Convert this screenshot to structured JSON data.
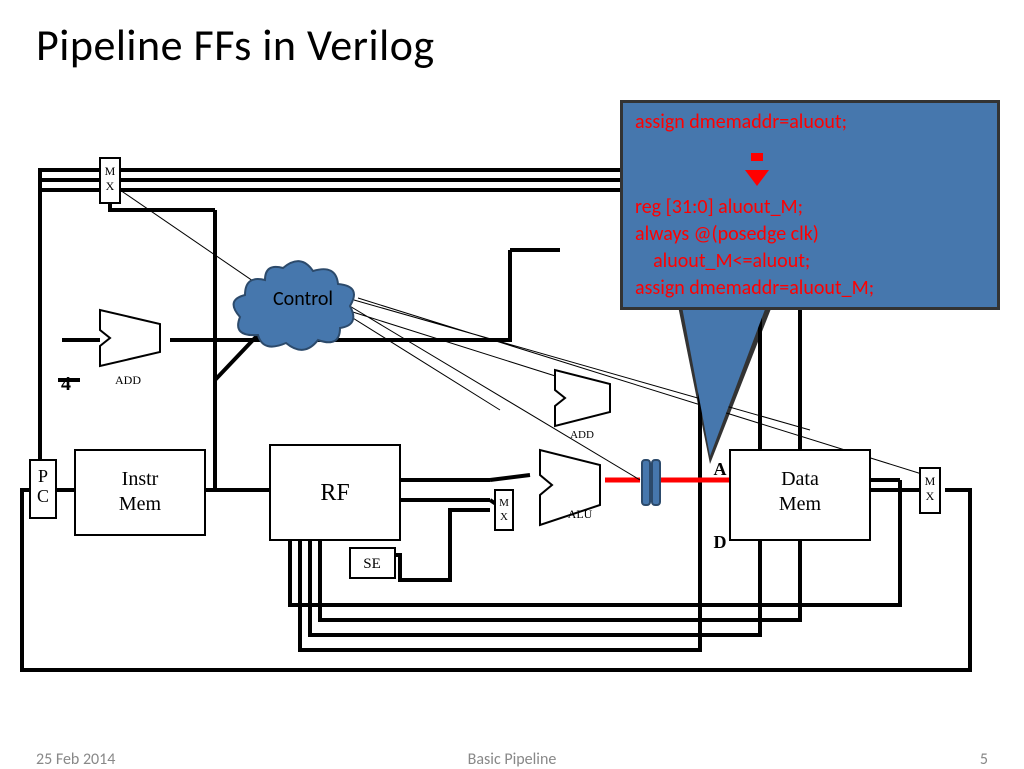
{
  "title": "Pipeline FFs in Verilog",
  "footer": {
    "date": "25 Feb 2014",
    "center": "Basic Pipeline",
    "page": "5"
  },
  "blocks": {
    "pc": "P\nC",
    "instrMem": "Instr\nMem",
    "rf": "RF",
    "se": "SE",
    "dataMem": "Data\nMem",
    "control": "Control",
    "alu": "ALU",
    "add1": "ADD",
    "add2": "ADD",
    "mx": "M\nX",
    "a": "A",
    "d": "D",
    "four": "4"
  },
  "code": {
    "l1": "assign dmemaddr=aluout;",
    "l2": "reg [31:0] aluout_M;",
    "l3": "always @(posedge clk)",
    "l4": "    aluout_M<=aluout;",
    "l5": "assign dmemaddr=aluout_M;"
  }
}
